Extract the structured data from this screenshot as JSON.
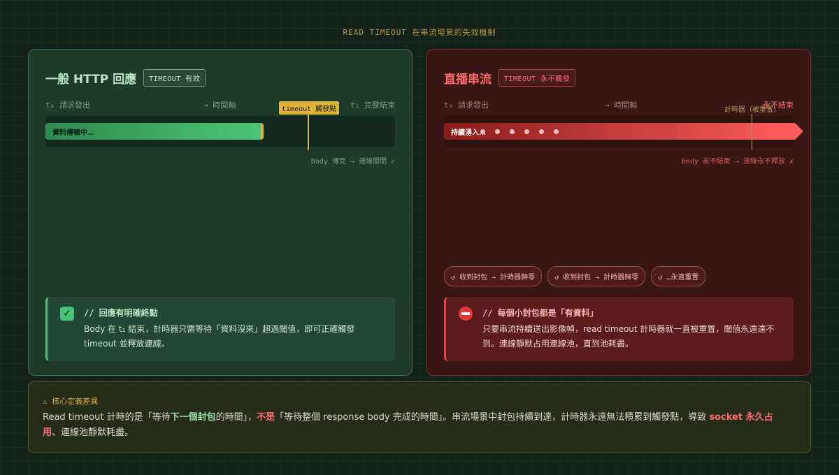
{
  "page_title": "READ TIMEOUT 在串流場景的失效機制",
  "left": {
    "heading": "一般 HTTP 回應",
    "tag": "TIMEOUT 有效",
    "t0_label": "t₀ 請求發出",
    "axis_label": "→ 時間軸",
    "t1_label": "t₁ 完整結束",
    "bar_label": "資料傳輸中…",
    "timeout_marker": "timeout 觸發點",
    "note": "Body 傳完 → 連線關閉 ✓",
    "callout": {
      "title": "// 回應有明確終點",
      "body": "Body 在 t₁ 結束，計時器只需等待「資料沒來」超過閾值，即可正確觸發 timeout 並釋放連線。"
    }
  },
  "right": {
    "heading": "直播串流",
    "tag": "TIMEOUT 永不觸發",
    "t0_label": "t₀ 請求發出",
    "axis_label": "→ 時間軸",
    "end_label": "永不結束",
    "timer_label": "計時器（被重置）",
    "bar_label": "持續湧入…",
    "packet_count": 6,
    "note": "Body 永不結束 → 連線永不釋放 ✗",
    "pills": [
      "↺ 收到封包 → 計時器歸零",
      "↺ 收到封包 → 計時器歸零",
      "↺ …永遠重置"
    ],
    "callout": {
      "title": "// 每個小封包都是「有資料」",
      "body": "只要串流持續送出影像幀，read timeout 計時器就一直被重置，閾值永遠達不到。連線靜默占用連線池，直到池耗盡。"
    }
  },
  "summary": {
    "label": "⚠ 核心定義差異",
    "p1": "Read timeout 計時的是「等待",
    "p2": "下一個封包",
    "p3": "的時間」，",
    "p4": "不是",
    "p5": "「等待整個 response body 完成的時間」。串流場景中封包持續到達，計時器永遠無法積累到觸發點，導致 ",
    "p6": "socket 永久占用",
    "p7": "、連線池靜默耗盡。"
  },
  "colors": {
    "valid_green": "#4cc477",
    "fail_red": "#ff5c5c",
    "timeout_amber": "#e0b23a"
  }
}
